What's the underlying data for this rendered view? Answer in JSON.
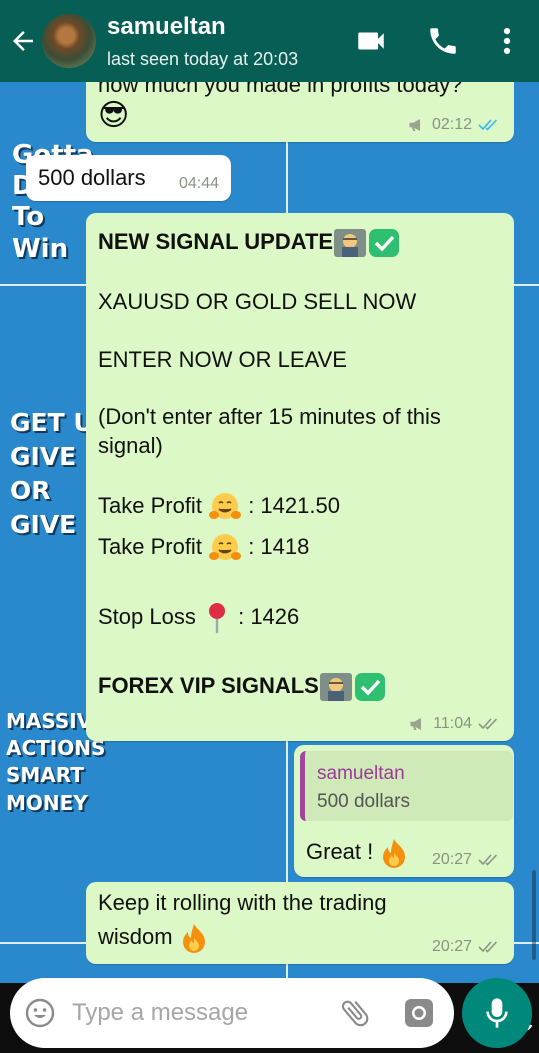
{
  "header": {
    "contact_name": "samueltan",
    "status": "last seen today at 20:03"
  },
  "wallpaper": {
    "text1": "Gotta\nDo\nTo\nWin",
    "text2": "GET UP\nGIVE IT\nOR\nGIVE UP",
    "text3": "MASSIVE\nACTIONS\nSMART\nMONEY",
    "bottom_text": "ZC"
  },
  "messages": {
    "m1": {
      "text": "how much you made in profits today?",
      "emoji": "😎",
      "time": "02:12"
    },
    "m2": {
      "text": "500 dollars",
      "time": "04:44"
    },
    "m3": {
      "title": "NEW SIGNAL UPDATE",
      "line1": "XAUUSD OR GOLD SELL NOW",
      "line2": "ENTER NOW OR LEAVE",
      "line3a": "(Don't enter after 15 minutes of this",
      "line3b": "signal)",
      "tp1_label": "Take Profit",
      "tp1_value": ": 1421.50",
      "tp2_label": "Take Profit",
      "tp2_value": ": 1418",
      "sl_label": "Stop Loss",
      "sl_value": ": 1426",
      "footer": "FOREX VIP SIGNALS",
      "time": "11:04"
    },
    "m4": {
      "quote_name": "samueltan",
      "quote_text": "500 dollars",
      "text": "Great !",
      "time": "20:27"
    },
    "m5": {
      "line1": "Keep it rolling with the trading",
      "line2": "wisdom",
      "time": "20:27"
    }
  },
  "composer": {
    "placeholder": "Type a message"
  },
  "colors": {
    "header": "#075e54",
    "outgoing": "#dcf8c6",
    "incoming": "#ffffff",
    "accent": "#00897b",
    "read_tick": "#34b7f1"
  },
  "icons": [
    "back-arrow-icon",
    "video-call-icon",
    "phone-icon",
    "more-options-icon",
    "emoji-icon",
    "attach-icon",
    "camera-icon",
    "mic-icon"
  ]
}
